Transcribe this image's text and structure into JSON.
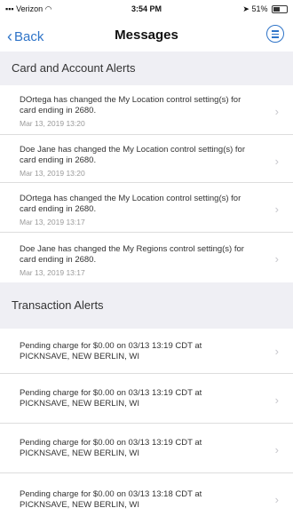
{
  "status_bar": {
    "carrier": "Verizon",
    "time": "3:54 PM",
    "battery": "51%",
    "battery_level": 0.51
  },
  "nav": {
    "back_label": "Back",
    "title": "Messages",
    "menu_icon": "menu-icon"
  },
  "sections": [
    {
      "title": "Card and Account Alerts",
      "items": [
        {
          "text": "DOrtega has changed the My Location control setting(s) for card ending in 2680.",
          "date": "Mar 13, 2019 13:20"
        },
        {
          "text": "Doe Jane has changed the My Location control setting(s) for card ending in 2680.",
          "date": "Mar 13, 2019 13:20"
        },
        {
          "text": "DOrtega has changed the My Location control setting(s) for card ending in 2680.",
          "date": "Mar 13, 2019 13:17"
        },
        {
          "text": "Doe Jane has changed the My Regions control setting(s) for card ending in 2680.",
          "date": "Mar 13, 2019 13:17"
        }
      ]
    },
    {
      "title": "Transaction Alerts",
      "items": [
        {
          "text": "Pending charge for $0.00 on 03/13 13:19 CDT at PICKNSAVE, NEW BERLIN, WI"
        },
        {
          "text": "Pending charge for $0.00 on 03/13 13:19 CDT at PICKNSAVE, NEW BERLIN, WI"
        },
        {
          "text": "Pending charge for $0.00 on 03/13 13:19 CDT at PICKNSAVE, NEW BERLIN, WI"
        },
        {
          "text": "Pending charge for $0.00 on 03/13 13:18 CDT at PICKNSAVE, NEW BERLIN, WI"
        }
      ]
    }
  ]
}
